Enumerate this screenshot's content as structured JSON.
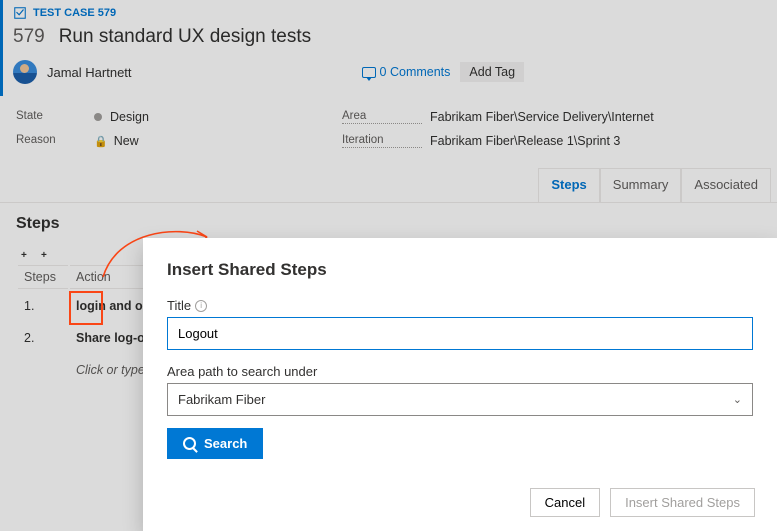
{
  "header": {
    "type_label": "TEST CASE 579",
    "id": "579",
    "title": "Run standard UX design tests",
    "assignee": "Jamal Hartnett",
    "comments_label": "0 Comments",
    "add_tag_label": "Add Tag"
  },
  "fields": {
    "state_label": "State",
    "state_value": "Design",
    "reason_label": "Reason",
    "reason_value": "New",
    "area_label": "Area",
    "area_value": "Fabrikam Fiber\\Service Delivery\\Internet",
    "iteration_label": "Iteration",
    "iteration_value": "Fabrikam Fiber\\Release 1\\Sprint 3"
  },
  "tabs": {
    "steps": "Steps",
    "summary": "Summary",
    "associated": "Associated"
  },
  "steps": {
    "heading": "Steps",
    "col_steps": "Steps",
    "col_action": "Action",
    "rows": [
      {
        "n": "1.",
        "action": "login and order item"
      },
      {
        "n": "2.",
        "action": "Share log-out"
      }
    ],
    "hint": "Click or type here to add a step"
  },
  "dialog": {
    "title": "Insert Shared Steps",
    "title_label": "Title",
    "title_value": "Logout",
    "area_label": "Area path to search under",
    "area_value": "Fabrikam Fiber",
    "search_label": "Search",
    "cancel_label": "Cancel",
    "insert_label": "Insert Shared Steps"
  }
}
